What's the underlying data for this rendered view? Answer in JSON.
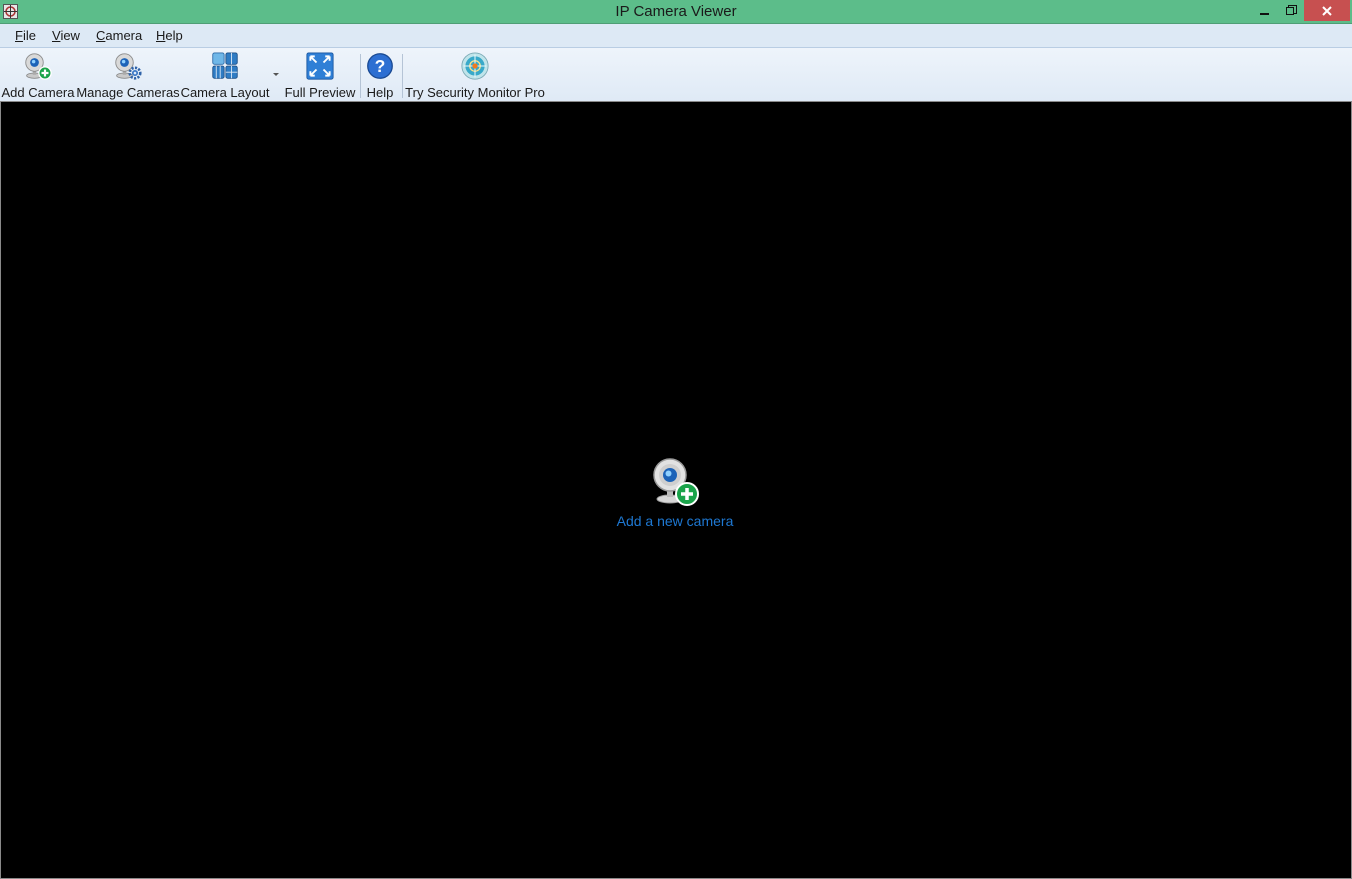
{
  "window": {
    "title": "IP Camera Viewer",
    "controls": [
      "minimize",
      "restore",
      "close"
    ]
  },
  "menu": {
    "items": [
      {
        "label": "File",
        "accel": "F",
        "rest": "ile"
      },
      {
        "label": "View",
        "accel": "V",
        "rest": "iew"
      },
      {
        "label": "Camera",
        "accel": "C",
        "rest": "amera"
      },
      {
        "label": "Help",
        "accel": "H",
        "rest": "elp"
      }
    ]
  },
  "toolbar": {
    "add_camera": "Add Camera",
    "manage_cameras": "Manage Cameras",
    "camera_layout": "Camera Layout",
    "full_preview": "Full Preview",
    "help": "Help",
    "try_pro": "Try Security Monitor Pro"
  },
  "viewport": {
    "add_new_camera": "Add a new camera"
  },
  "colors": {
    "titlebar": "#5cbd8a",
    "close": "#c75050",
    "link": "#1e78d2"
  }
}
